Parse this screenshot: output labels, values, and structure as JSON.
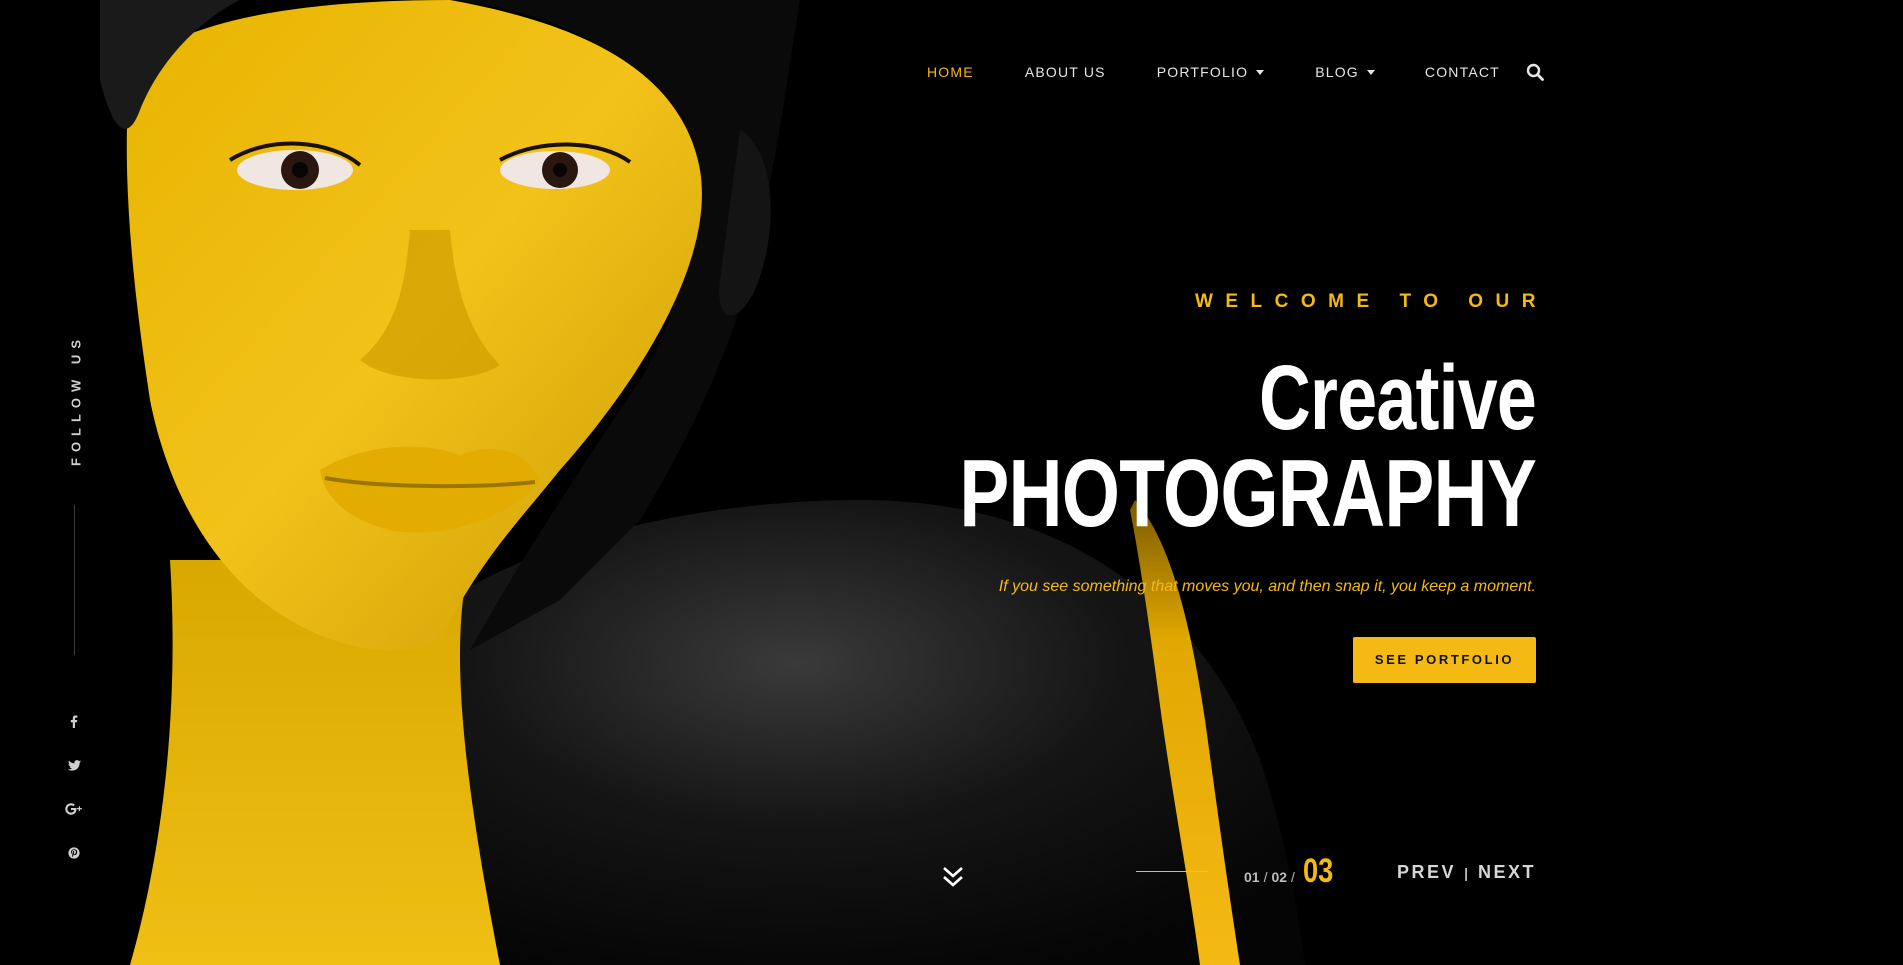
{
  "nav": {
    "items": [
      {
        "label": "HOME",
        "active": true,
        "has_dropdown": false
      },
      {
        "label": "ABOUT US",
        "active": false,
        "has_dropdown": false
      },
      {
        "label": "PORTFOLIO",
        "active": false,
        "has_dropdown": true
      },
      {
        "label": "BLOG",
        "active": false,
        "has_dropdown": true
      },
      {
        "label": "CONTACT",
        "active": false,
        "has_dropdown": false
      }
    ],
    "search_icon": "search-icon"
  },
  "sidebar": {
    "follow_label": "FOLLOW US",
    "social": [
      {
        "name": "facebook-icon",
        "glyph": "f"
      },
      {
        "name": "twitter-icon",
        "glyph": "🐦"
      },
      {
        "name": "google-plus-icon",
        "glyph": "G+"
      },
      {
        "name": "pinterest-icon",
        "glyph": "℗"
      }
    ]
  },
  "hero": {
    "kicker": "WELCOME TO OUR",
    "title_line1": "Creative",
    "title_line2": "PHOTOGRAPHY",
    "tagline": "If you see something that moves you, and then snap it, you keep a moment.",
    "cta_label": "SEE PORTFOLIO"
  },
  "slider": {
    "slide1": "01",
    "slide2": "02",
    "separator": "/",
    "current": "03",
    "prev_label": "PREV",
    "next_label": "NEXT",
    "divider": "|"
  },
  "colors": {
    "accent": "#f5b914",
    "background": "#000000",
    "text": "#ffffff"
  }
}
